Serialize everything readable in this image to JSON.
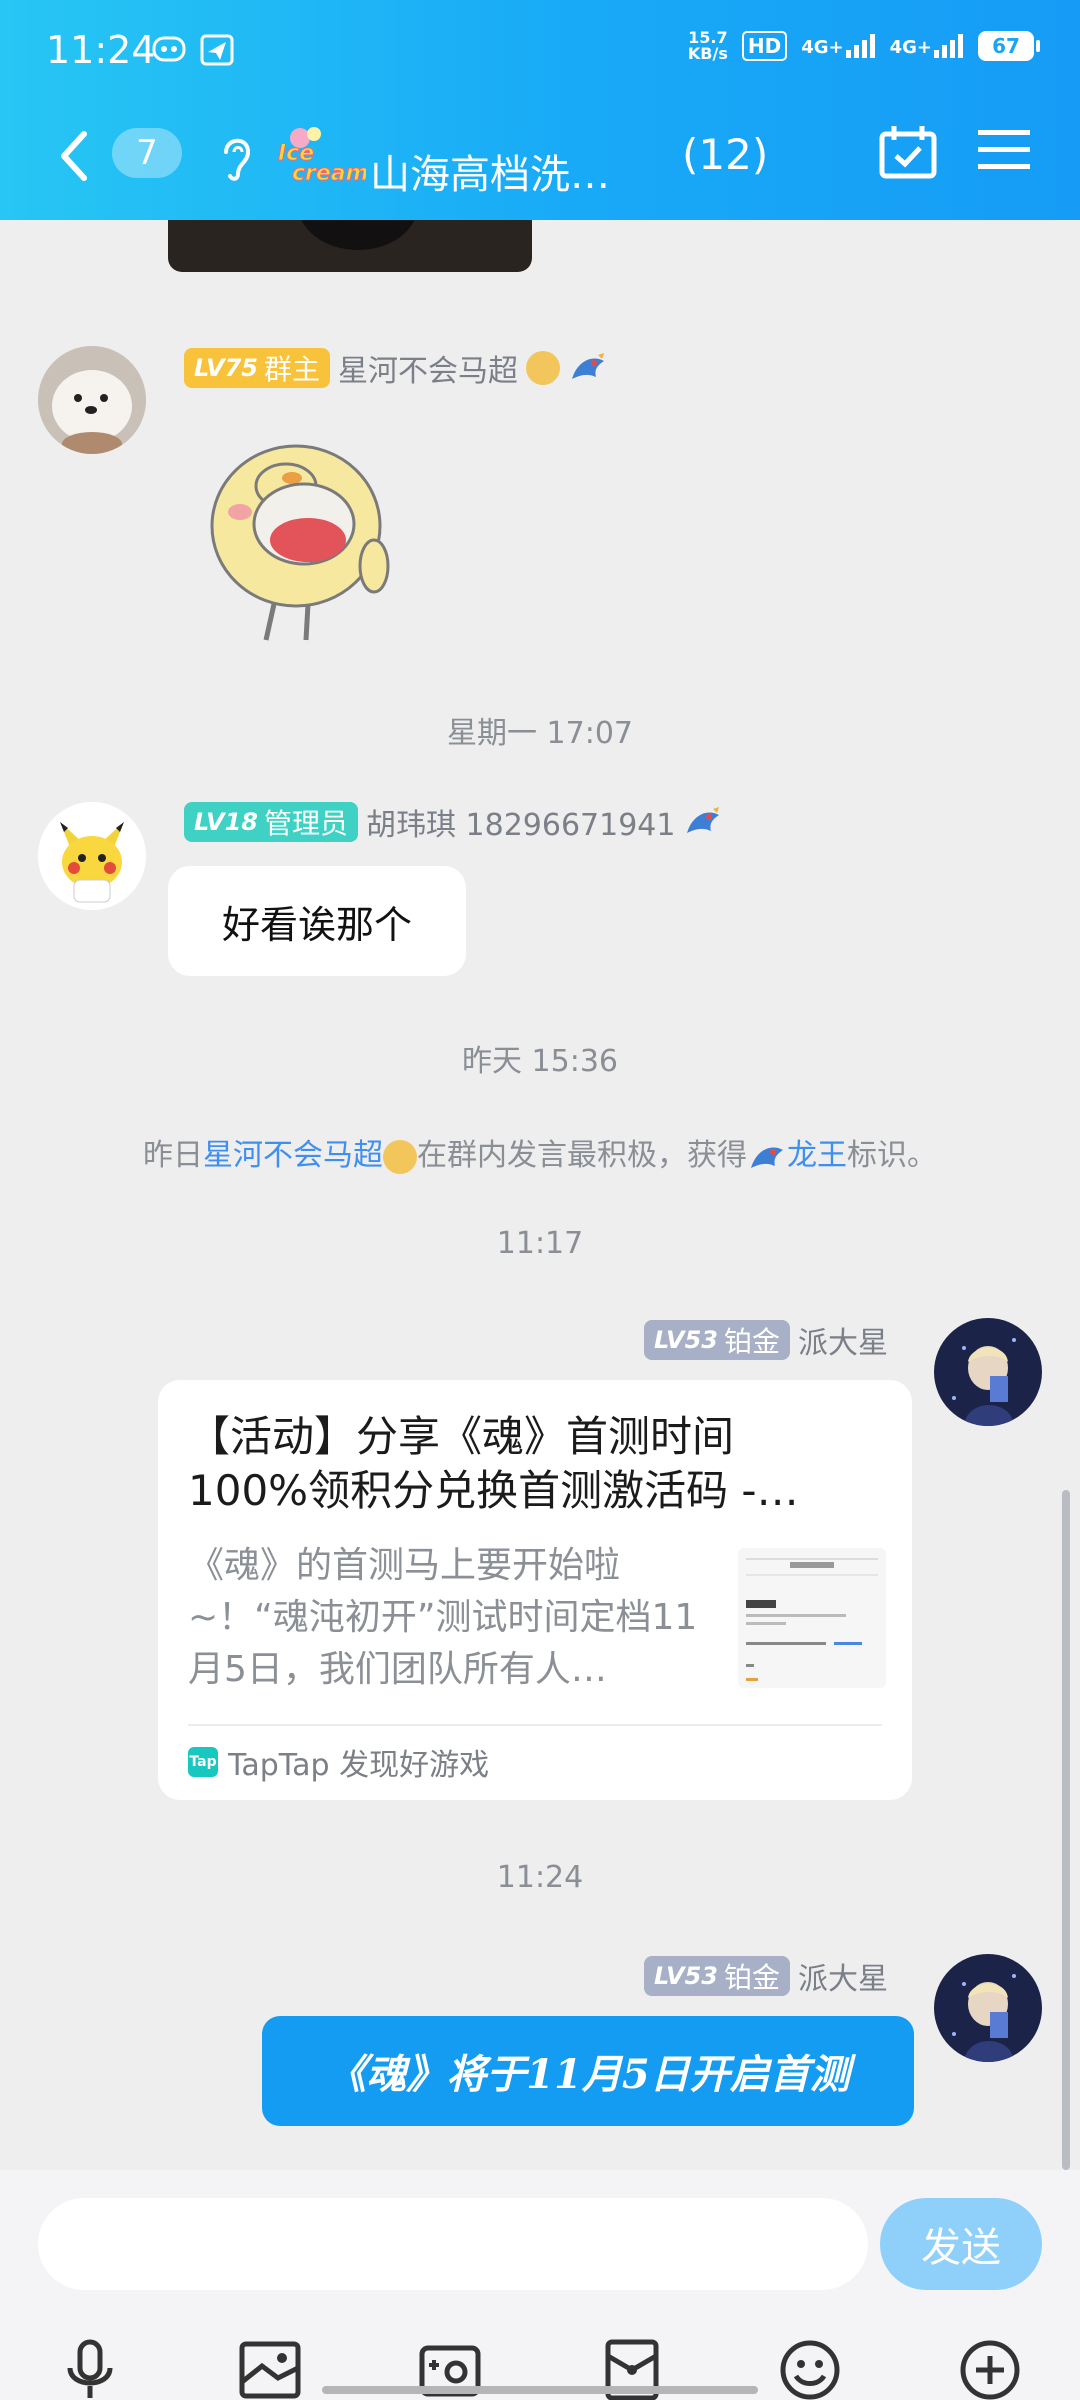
{
  "status_bar": {
    "time": "11:24",
    "speed_top": "15.7",
    "speed_unit": "KB/s",
    "hd": "HD",
    "net1": "4G+",
    "net2": "4G+",
    "battery": "67"
  },
  "header": {
    "unread_count": "7",
    "logo_text": "Ice cream",
    "title": "山海高档洗…",
    "member_count": "(12)"
  },
  "messages": [
    {
      "badge_level": "LV75",
      "badge_role": "群主",
      "sender": "星河不会马超",
      "type": "sticker"
    },
    {
      "time_label": "星期一 17:07"
    },
    {
      "badge_level": "LV18",
      "badge_role": "管理员",
      "sender": "胡玮琪  18296671941",
      "text": "好看诶那个"
    },
    {
      "time_label": "昨天 15:36"
    },
    {
      "system": {
        "prefix": "昨日",
        "user": "星河不会马超",
        "middle": "在群内发言最积极，获得",
        "title": "龙王",
        "suffix": "标识。"
      }
    },
    {
      "time_label": "11:17"
    },
    {
      "badge_level": "LV53",
      "badge_role": "铂金",
      "sender": "派大星",
      "card": {
        "title_line1": "【活动】分享《魂》首测时间",
        "title_line2": "100%领积分兑换首测激活码 -…",
        "desc": "《魂》的首测马上要开始啦~！“魂沌初开”测试时间定档11月5日，我们团队所有人…",
        "source": "TapTap 发现好游戏",
        "tap_icon": "Tap"
      }
    },
    {
      "time_label": "11:24"
    },
    {
      "badge_level": "LV53",
      "badge_role": "铂金",
      "sender": "派大星",
      "text": "《魂》将于11月5日开启首测"
    }
  ],
  "input": {
    "placeholder": "",
    "send_label": "发送"
  },
  "toolbar": [
    "microphone-icon",
    "picture-icon",
    "camera-icon",
    "red-packet-icon",
    "emoji-icon",
    "plus-icon"
  ],
  "colors": {
    "header_start": "#27c6f4",
    "header_end": "#169cf6",
    "bubble_blue": "#149cf2",
    "link": "#3f8ff0"
  }
}
